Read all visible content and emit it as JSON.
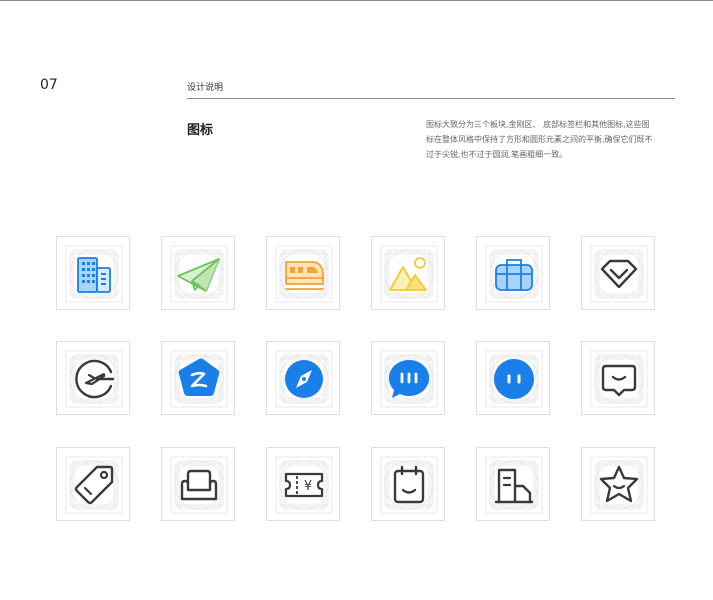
{
  "page": {
    "number": "07",
    "section_title": "设计说明",
    "heading": "图标",
    "description_lines": [
      "图标大致分为三个板块,金刚区、  底部标签栏和其他图标,这些图",
      "标在整体风格中保持了方形和圆形元素之间的平衡,确保它们既不",
      "过于尖锐,也不过于圆润,笔画粗细一致。"
    ]
  },
  "icons": [
    [
      "hotel-building-icon",
      "paper-plane-icon",
      "train-icon",
      "mountain-sun-icon",
      "suitcase-icon",
      "diamond-badge-icon"
    ],
    [
      "flight-circle-icon",
      "pentagon-z-icon",
      "compass-icon",
      "chat-bubble-icon",
      "face-circle-icon",
      "message-face-icon"
    ],
    [
      "price-tag-icon",
      "sofa-icon",
      "ticket-yen-icon",
      "calendar-smile-icon",
      "office-building-icon",
      "star-smile-icon"
    ]
  ],
  "ticket_symbol": "¥",
  "colors": {
    "blue": "#1a7fe8",
    "light_blue": "#a9d3f7",
    "green": "#6cc35a",
    "light_green": "#d8f1cf",
    "orange": "#f2a335",
    "light_orange": "#fde3b6",
    "yellow": "#f3c93a",
    "light_yellow": "#fcefb8",
    "dark": "#3a3a3a",
    "grid": "#e2e2e2"
  }
}
